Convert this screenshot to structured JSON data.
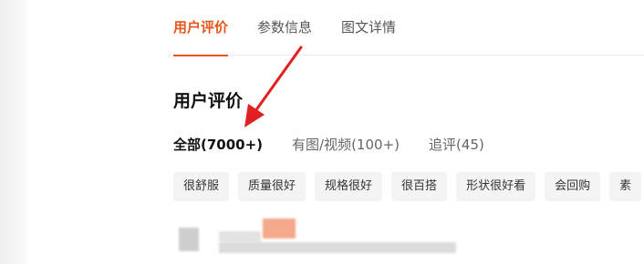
{
  "tabs": [
    {
      "label": "用户评价",
      "active": true
    },
    {
      "label": "参数信息",
      "active": false
    },
    {
      "label": "图文详情",
      "active": false
    }
  ],
  "section_title": "用户评价",
  "filters": [
    {
      "label": "全部(7000+)",
      "active": true
    },
    {
      "label": "有图/视频(100+)",
      "active": false
    },
    {
      "label": "追评(45)",
      "active": false
    }
  ],
  "chips": [
    "很舒服",
    "质量很好",
    "规格很好",
    "很百搭",
    "形状很好看",
    "会回购",
    "素"
  ],
  "colors": {
    "accent": "#e8541a",
    "annotation_arrow": "#e02020"
  }
}
